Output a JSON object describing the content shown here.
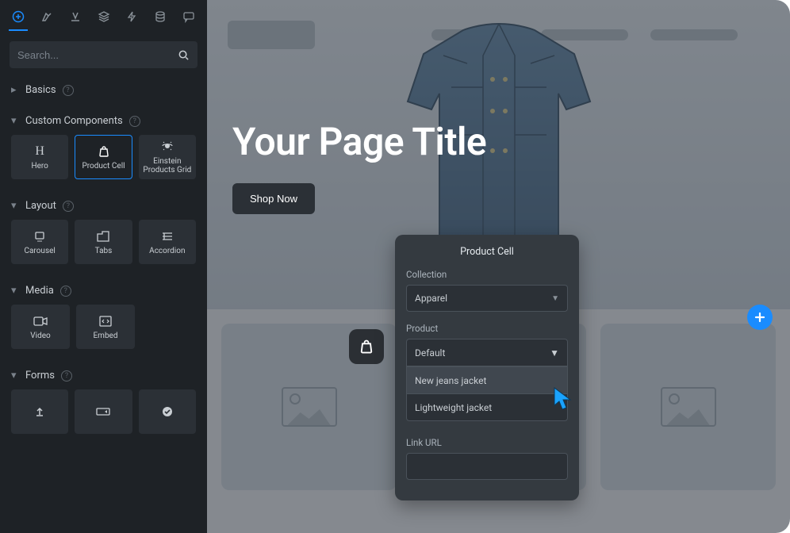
{
  "sidebar": {
    "search_placeholder": "Search...",
    "sections": {
      "basics": "Basics",
      "custom": "Custom Components",
      "layout": "Layout",
      "media": "Media",
      "forms": "Forms"
    },
    "custom_tiles": [
      {
        "label": "Hero"
      },
      {
        "label": "Product Cell"
      },
      {
        "label": "Einstein Products Grid"
      }
    ],
    "layout_tiles": [
      {
        "label": "Carousel"
      },
      {
        "label": "Tabs"
      },
      {
        "label": "Accordion"
      }
    ],
    "media_tiles": [
      {
        "label": "Video"
      },
      {
        "label": "Embed"
      }
    ]
  },
  "canvas": {
    "hero_title": "Your Page Title",
    "hero_button": "Shop Now"
  },
  "popover": {
    "title": "Product Cell",
    "collection_label": "Collection",
    "collection_value": "Apparel",
    "product_label": "Product",
    "product_value": "Default",
    "product_options": [
      "New jeans jacket",
      "Lightweight jacket"
    ],
    "link_url_label": "Link URL"
  }
}
